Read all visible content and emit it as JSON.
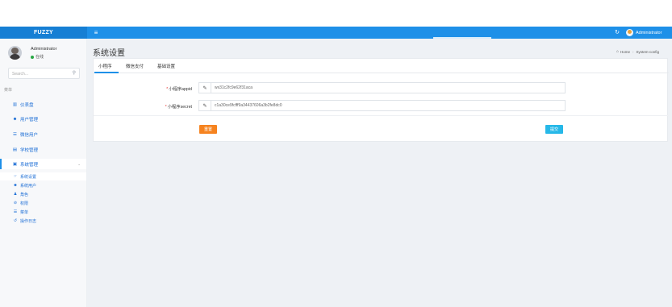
{
  "navbar": {
    "logo": "FUZZY",
    "menu_toggle_icon": "hamburger-icon",
    "refresh_icon": "refresh-icon",
    "username": "Administrator",
    "bg_color": "#1e90e8"
  },
  "sidebar": {
    "username": "Administrator",
    "status": "在线",
    "search_placeholder": "Search...",
    "menu_header": "菜单",
    "items": [
      {
        "label": "仪表盘",
        "icon": "dashboard-icon"
      },
      {
        "label": "用户管理",
        "icon": "users-icon"
      },
      {
        "label": "微信用户",
        "icon": "list-icon"
      },
      {
        "label": "学校管理",
        "icon": "id-card-icon"
      },
      {
        "label": "系统管理",
        "icon": "system-icon"
      }
    ],
    "sub_items": [
      {
        "label": "系统设置",
        "icon": "settings-icon"
      },
      {
        "label": "系统用户",
        "icon": "users-icon"
      },
      {
        "label": "角色",
        "icon": "user-icon"
      },
      {
        "label": "权限",
        "icon": "ban-icon"
      },
      {
        "label": "菜单",
        "icon": "list-icon"
      },
      {
        "label": "操作日志",
        "icon": "history-icon"
      }
    ]
  },
  "main": {
    "title": "系统设置",
    "breadcrumb": {
      "home": "Home",
      "current": "System-config"
    },
    "tabs": [
      "小程序",
      "微信支付",
      "基础设置"
    ],
    "form": {
      "fields": [
        {
          "label": "小程序appid",
          "value": "wx31c2fc9e62f31aca",
          "required": true
        },
        {
          "label": "小程序secret",
          "value": "c1a30ce9fcfff9a34437606a3b2fe8dc0",
          "required": true
        }
      ],
      "reset_label": "重置",
      "submit_label": "提交"
    }
  },
  "colors": {
    "accent": "#1e90e8",
    "reset_button": "#f6831f",
    "submit_button": "#26b8e8",
    "required": "#e53935"
  }
}
